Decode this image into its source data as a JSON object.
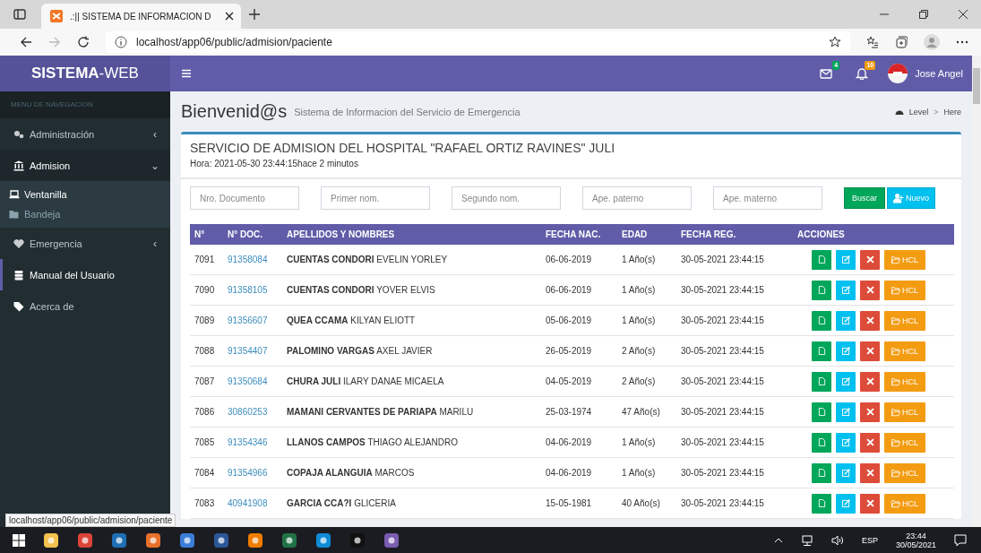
{
  "browser": {
    "tab_title": ".:|| SISTEMA DE INFORMACION D",
    "address": "localhost/app06/public/admision/paciente"
  },
  "header": {
    "brand": "**SISTEMA**-WEB",
    "mail_badge": "4",
    "bell_badge": "10",
    "user": "Jose Angel"
  },
  "sidebar": {
    "heading": "MENU DE NAVEGACION",
    "items": [
      {
        "label": "Administración",
        "expanded": false,
        "selected": false,
        "caret": "‹"
      },
      {
        "label": "Admision",
        "expanded": true,
        "selected": false,
        "caret": "⌄",
        "children": [
          {
            "label": "Ventanilla",
            "selected": true
          },
          {
            "label": "Bandeja",
            "selected": false
          }
        ]
      },
      {
        "label": "Emergencia",
        "expanded": false,
        "selected": false,
        "caret": "‹"
      },
      {
        "label": "Manual del Usuario",
        "selected": true
      },
      {
        "label": "Acerca de",
        "selected": false
      }
    ]
  },
  "page": {
    "title": "Bienvenid@s",
    "subtitle": "Sistema de Informacion del Servicio de Emergencia",
    "breadcrumb": [
      "Level",
      "Here"
    ],
    "breadcrumb_separator": ">"
  },
  "box": {
    "title": "SERVICIO DE ADMISION DEL HOSPITAL \"RAFAEL ORTIZ RAVINES\" JULI",
    "time": "Hora: 2021-05-30 23:44:15hace 2 minutos"
  },
  "filters": [
    {
      "placeholder": "Nro. Documento"
    },
    {
      "placeholder": "Primer nom."
    },
    {
      "placeholder": "Segundo nom."
    },
    {
      "placeholder": "Ape. paterno"
    },
    {
      "placeholder": "Ape. materno"
    }
  ],
  "buttons": {
    "search": "Buscar",
    "new": "Nuevo"
  },
  "table": {
    "columns": [
      "N°",
      "N° DOC.",
      "APELLIDOS Y NOMBRES",
      "FECHA NAC.",
      "EDAD",
      "FECHA REG.",
      "ACCIONES"
    ],
    "rows": [
      {
        "num": "7091",
        "doc": "91358084",
        "surname": "CUENTAS CONDORI",
        "names": "EVELIN YORLEY",
        "birth": "06-06-2019",
        "age": "1 Año(s)",
        "reg": "30-05-2021 23:44:15",
        "hcl": "HCL"
      },
      {
        "num": "7090",
        "doc": "91358105",
        "surname": "CUENTAS CONDORI",
        "names": "YOVER ELVIS",
        "birth": "06-06-2019",
        "age": "1 Año(s)",
        "reg": "30-05-2021 23:44:15",
        "hcl": "HCL"
      },
      {
        "num": "7089",
        "doc": "91356607",
        "surname": "QUEA CCAMA",
        "names": "KILYAN ELIOTT",
        "birth": "05-06-2019",
        "age": "1 Año(s)",
        "reg": "30-05-2021 23:44:15",
        "hcl": "HCL"
      },
      {
        "num": "7088",
        "doc": "91354407",
        "surname": "PALOMINO VARGAS",
        "names": "AXEL JAVIER",
        "birth": "26-05-2019",
        "age": "2 Año(s)",
        "reg": "30-05-2021 23:44:15",
        "hcl": "HCL"
      },
      {
        "num": "7087",
        "doc": "91350684",
        "surname": "CHURA JULI",
        "names": "ILARY DANAE MICAELA",
        "birth": "04-05-2019",
        "age": "2 Año(s)",
        "reg": "30-05-2021 23:44:15",
        "hcl": "HCL"
      },
      {
        "num": "7086",
        "doc": "30860253",
        "surname": "MAMANI CERVANTES DE PARIAPA",
        "names": "MARILU",
        "birth": "25-03-1974",
        "age": "47 Año(s)",
        "reg": "30-05-2021 23:44:15",
        "hcl": "HCL"
      },
      {
        "num": "7085",
        "doc": "91354346",
        "surname": "LLANOS CAMPOS",
        "names": "THIAGO ALEJANDRO",
        "birth": "04-06-2019",
        "age": "1 Año(s)",
        "reg": "30-05-2021 23:44:15",
        "hcl": "HCL"
      },
      {
        "num": "7084",
        "doc": "91354966",
        "surname": "COPAJA ALANGUIA",
        "names": "MARCOS",
        "birth": "04-06-2019",
        "age": "1 Año(s)",
        "reg": "30-05-2021 23:44:15",
        "hcl": "HCL"
      },
      {
        "num": "7083",
        "doc": "40941908",
        "surname": "GARCIA CCA?I",
        "names": "GLICERIA",
        "birth": "15-05-1981",
        "age": "40 Año(s)",
        "reg": "30-05-2021 23:44:15",
        "hcl": "HCL"
      }
    ]
  },
  "status_url": "localhost/app06/public/admision/paciente",
  "taskbar": {
    "language": "ESP",
    "time": "23:44",
    "date": "30/05/2021"
  }
}
